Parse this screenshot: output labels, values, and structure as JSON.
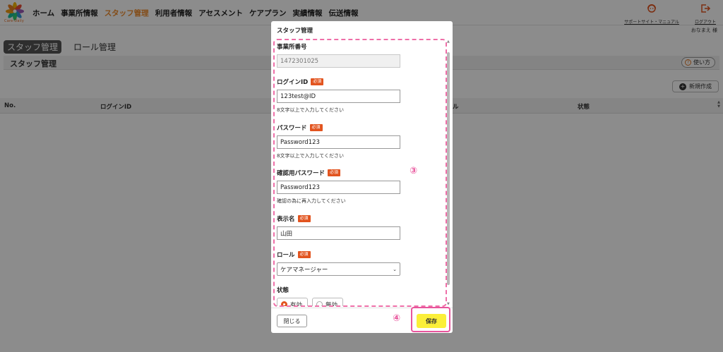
{
  "app": {
    "logo_text": "Care-Daily",
    "nav": [
      "ホーム",
      "事業所情報",
      "スタッフ管理",
      "利用者情報",
      "アセスメント",
      "ケアプラン",
      "実績情報",
      "伝送情報"
    ],
    "active_nav_index": 2,
    "support_label": "サポートサイト・マニュアル",
    "logout_label": "ログアウト",
    "user_name": "おなまえ 様"
  },
  "page": {
    "tabs": [
      "スタッフ管理",
      "ロール管理"
    ],
    "section_title": "スタッフ管理",
    "usage_label": "使い方",
    "new_label": "新規作成",
    "columns": [
      "No.",
      "ログインID",
      "ル",
      "状態"
    ]
  },
  "modal": {
    "title": "スタッフ管理",
    "required_badge": "必須",
    "office_number": {
      "label": "事業所番号",
      "value": "1472301025"
    },
    "login_id": {
      "label": "ログインID",
      "value": "123test@ID",
      "hint": "8文字以上で入力してください"
    },
    "password": {
      "label": "パスワード",
      "value": "Password123",
      "hint": "8文字以上で入力してください"
    },
    "confirm_password": {
      "label": "確認用パスワード",
      "value": "Password123",
      "hint": "確認の為に再入力してください"
    },
    "display_name": {
      "label": "表示名",
      "value": "山田"
    },
    "role": {
      "label": "ロール",
      "value": "ケアマネージャー"
    },
    "status": {
      "label": "状態",
      "options": [
        "有効",
        "無効"
      ],
      "selected": "有効"
    },
    "close_label": "閉じる",
    "save_label": "保存"
  },
  "annotations": {
    "marker_3": "③",
    "marker_4": "④",
    "color": "#e8559c"
  },
  "colors": {
    "accent": "#ee8a2b",
    "required": "#e2541f",
    "save": "#fbef39"
  }
}
